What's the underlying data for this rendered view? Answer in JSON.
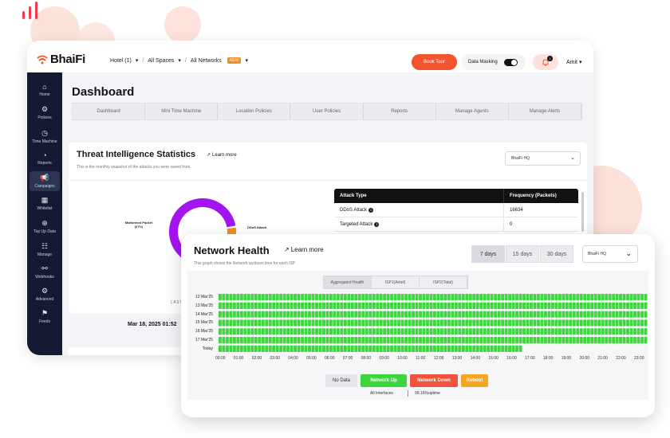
{
  "colors": {
    "accent": "#f2542d",
    "sidebar": "#141a33",
    "up_green": "#3fd53f",
    "down_red": "#f0533a",
    "reboot_orange": "#f5a623",
    "donut_purple": "#a314f0",
    "donut_orange": "#f68b1f"
  },
  "header": {
    "logo": "BhaiFi",
    "breadcrumbs": [
      "Hotel (1)",
      "/",
      "All Spaces",
      "/",
      "All Networks"
    ],
    "new_badge": "NEW",
    "book_tour": "Book Tour",
    "data_masking": "Data Masking",
    "notifications_count": "2",
    "user": "Amit"
  },
  "sidebar": {
    "items": [
      {
        "label": "Home",
        "icon": "home-icon"
      },
      {
        "label": "Policies",
        "icon": "policies-icon"
      },
      {
        "label": "Time Machine",
        "icon": "clock-icon"
      },
      {
        "label": "Reports",
        "icon": "pie-icon"
      },
      {
        "label": "Campaigns",
        "icon": "megaphone-icon"
      },
      {
        "label": "Whitelist",
        "icon": "grid-icon"
      },
      {
        "label": "Top Up Data",
        "icon": "plus-circle-icon"
      },
      {
        "label": "Manage",
        "icon": "sliders-icon"
      },
      {
        "label": "Webhooks",
        "icon": "webhook-icon"
      },
      {
        "label": "Advanced",
        "icon": "gear-icon"
      },
      {
        "label": "Feeds",
        "icon": "flag-icon"
      }
    ]
  },
  "dashboard": {
    "title": "Dashboard",
    "tabs": [
      "Dashboard",
      "Mini Time Machine",
      "Location Policies",
      "User Policies",
      "Reports",
      "Manage Agents",
      "Manage Alerts"
    ],
    "threat": {
      "title": "Threat Intelligence Statistics",
      "learn_more": "Learn more",
      "subtitle": "This is the monthly snapshot of the attacks you were saved from.",
      "selector": "BhaiFi HQ",
      "donut": {
        "slices": [
          {
            "name": "Malformed Packet",
            "percent": 67,
            "label": "Malformed Packet\n(67%)"
          },
          {
            "name": "DDoS Attack",
            "percent": 33,
            "label": "DDoS Attack"
          }
        ]
      },
      "table": {
        "headers": [
          "Attack Type",
          "Frequency (Packets)"
        ],
        "rows": [
          [
            "DDoS Attack",
            "16634"
          ],
          [
            "Targeted Attack",
            "0"
          ]
        ]
      },
      "last_updated_label": "LAST UPDATED",
      "last_updated_value": "Mar 18, 2025 01:52"
    }
  },
  "network_health": {
    "title": "Network Health",
    "learn_more": "Learn more",
    "subtitle": "This graph shows the Network up/down time for each ISP",
    "ranges": [
      "7 days",
      "15 days",
      "30 days"
    ],
    "active_range": 0,
    "selector": "BhaiFi HQ",
    "views": [
      "Aggregated Health",
      "ISP1(Airtel)",
      "ISP2(Tatal)"
    ],
    "active_view": 0,
    "rows": [
      "12 Mar'25",
      "13 Mar'25",
      "14 Mar'25",
      "15 Mar'25",
      "16 Mar'25",
      "17 Mar'25",
      "Today"
    ],
    "today_fraction": 0.71,
    "hours": [
      "00:00",
      "01:00",
      "02:00",
      "03:00",
      "04:00",
      "05:00",
      "06:00",
      "07:00",
      "08:00",
      "09:00",
      "10:00",
      "11:00",
      "12:00",
      "13:00",
      "14:00",
      "15:00",
      "16:00",
      "17:00",
      "18:00",
      "19:00",
      "20:00",
      "21:00",
      "22:00",
      "23:00"
    ],
    "legend": [
      "No Data",
      "Network Up",
      "Network Down",
      "Reboot"
    ],
    "interfaces_label": "All Interfaces",
    "uptime_label": "99.16%uptime"
  }
}
